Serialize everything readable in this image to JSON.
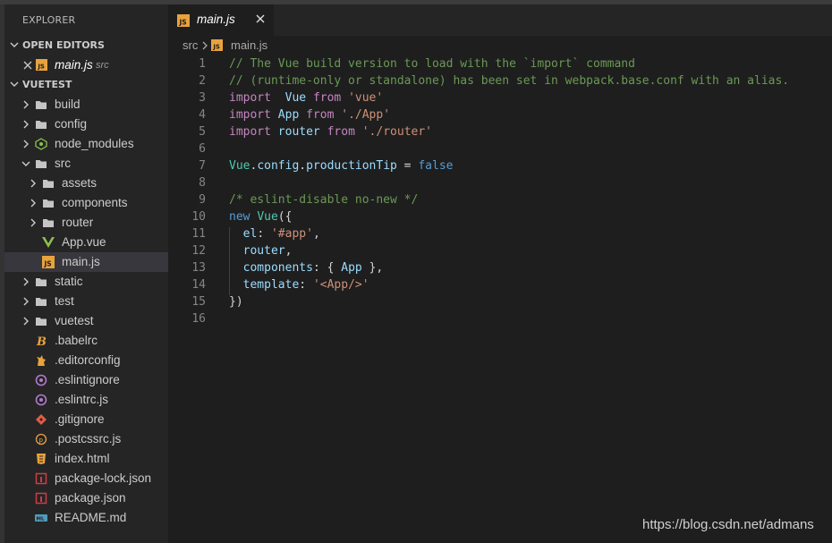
{
  "explorer": {
    "title": "EXPLORER",
    "open_editors": {
      "label": "OPEN EDITORS",
      "items": [
        {
          "name": "main.js",
          "folder": "src"
        }
      ]
    },
    "project": {
      "label": "VUETEST",
      "items": [
        {
          "label": "build",
          "icon": "folder-icon"
        },
        {
          "label": "config",
          "icon": "folder-icon"
        },
        {
          "label": "node_modules",
          "icon": "node-modules-icon"
        },
        {
          "label": "src",
          "icon": "folder-icon"
        },
        {
          "label": "assets",
          "icon": "folder-icon"
        },
        {
          "label": "components",
          "icon": "folder-icon"
        },
        {
          "label": "router",
          "icon": "folder-icon"
        },
        {
          "label": "App.vue",
          "icon": "vue-file-icon"
        },
        {
          "label": "main.js",
          "icon": "js-file-icon"
        },
        {
          "label": "static",
          "icon": "folder-icon"
        },
        {
          "label": "test",
          "icon": "folder-icon"
        },
        {
          "label": "vuetest",
          "icon": "folder-icon"
        },
        {
          "label": ".babelrc",
          "icon": "babel-icon"
        },
        {
          "label": ".editorconfig",
          "icon": "editorconfig-icon"
        },
        {
          "label": ".eslintignore",
          "icon": "eslint-icon"
        },
        {
          "label": ".eslintrc.js",
          "icon": "eslint-icon"
        },
        {
          "label": ".gitignore",
          "icon": "git-icon"
        },
        {
          "label": ".postcssrc.js",
          "icon": "postcss-icon"
        },
        {
          "label": "index.html",
          "icon": "html-file-icon"
        },
        {
          "label": "package-lock.json",
          "icon": "npm-icon"
        },
        {
          "label": "package.json",
          "icon": "npm-icon"
        },
        {
          "label": "README.md",
          "icon": "markdown-icon"
        }
      ]
    }
  },
  "tab": {
    "label": "main.js",
    "icon": "js-file-icon"
  },
  "breadcrumb": {
    "folder": "src",
    "file": "main.js"
  },
  "code": {
    "line_numbers": [
      "1",
      "2",
      "3",
      "4",
      "5",
      "6",
      "7",
      "8",
      "9",
      "10",
      "11",
      "12",
      "13",
      "14",
      "15",
      "16"
    ],
    "lines": [
      [
        [
          "c-com",
          "// The Vue build version to load with the `import` command"
        ]
      ],
      [
        [
          "c-com",
          "// (runtime-only or standalone) has been set in webpack.base.conf with an alias."
        ]
      ],
      [
        [
          "c-kw",
          "import"
        ],
        [
          "",
          "  "
        ],
        [
          "c-var",
          "Vue"
        ],
        [
          "",
          " "
        ],
        [
          "c-kw",
          "from"
        ],
        [
          "",
          " "
        ],
        [
          "c-str",
          "'vue'"
        ]
      ],
      [
        [
          "c-kw",
          "import"
        ],
        [
          "",
          " "
        ],
        [
          "c-var",
          "App"
        ],
        [
          "",
          " "
        ],
        [
          "c-kw",
          "from"
        ],
        [
          "",
          " "
        ],
        [
          "c-str",
          "'./App'"
        ]
      ],
      [
        [
          "c-kw",
          "import"
        ],
        [
          "",
          " "
        ],
        [
          "c-var",
          "router"
        ],
        [
          "",
          " "
        ],
        [
          "c-kw",
          "from"
        ],
        [
          "",
          " "
        ],
        [
          "c-str",
          "'./router'"
        ]
      ],
      [],
      [
        [
          "c-cls",
          "Vue"
        ],
        [
          "",
          "."
        ],
        [
          "c-var",
          "config"
        ],
        [
          "",
          "."
        ],
        [
          "c-var",
          "productionTip"
        ],
        [
          "",
          " = "
        ],
        [
          "c-kw2",
          "false"
        ]
      ],
      [],
      [
        [
          "c-com",
          "/* eslint-disable no-new */"
        ]
      ],
      [
        [
          "c-kw2",
          "new"
        ],
        [
          "",
          " "
        ],
        [
          "c-cls",
          "Vue"
        ],
        [
          "",
          "({"
        ]
      ],
      [
        [
          "",
          "  "
        ],
        [
          "c-var",
          "el"
        ],
        [
          "",
          ": "
        ],
        [
          "c-str",
          "'#app'"
        ],
        [
          "",
          ","
        ]
      ],
      [
        [
          "",
          "  "
        ],
        [
          "c-var",
          "router"
        ],
        [
          "",
          ","
        ]
      ],
      [
        [
          "",
          "  "
        ],
        [
          "c-var",
          "components"
        ],
        [
          "",
          ": { "
        ],
        [
          "c-var",
          "App"
        ],
        [
          "",
          " },"
        ]
      ],
      [
        [
          "",
          "  "
        ],
        [
          "c-var",
          "template"
        ],
        [
          "",
          ": "
        ],
        [
          "c-str",
          "'<App/>'"
        ]
      ],
      [
        [
          "",
          "})"
        ]
      ],
      []
    ]
  },
  "watermark": "https://blog.csdn.net/admans",
  "colors": {
    "editor_bg": "#1e1e1e",
    "sidebar_bg": "#252526",
    "comment": "#6a9955",
    "keyword": "#c586c0",
    "string": "#ce9178",
    "variable": "#9cdcfe"
  }
}
